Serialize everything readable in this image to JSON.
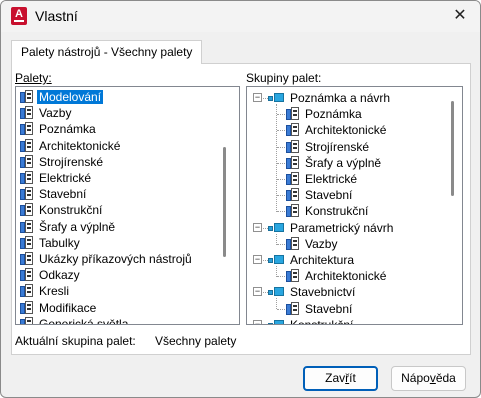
{
  "window": {
    "title": "Vlastní",
    "app_icon_letter": "A"
  },
  "tab": {
    "label": "Palety nástrojů - Všechny palety"
  },
  "palettes": {
    "label": "Palety:",
    "items": [
      "Modelování",
      "Vazby",
      "Poznámka",
      "Architektonické",
      "Strojírenské",
      "Elektrické",
      "Stavební",
      "Konstrukční",
      "Šrafy a výplně",
      "Tabulky",
      "Ukázky příkazových nástrojů",
      "Odkazy",
      "Kresli",
      "Modifikace",
      "Generická světla"
    ],
    "selected": "Modelování"
  },
  "groups": {
    "label": "Skupiny palet:",
    "tree": [
      {
        "name": "Poznámka a návrh",
        "children": [
          "Poznámka",
          "Architektonické",
          "Strojírenské",
          "Šrafy a výplně",
          "Elektrické",
          "Stavební",
          "Konstrukční"
        ]
      },
      {
        "name": "Parametrický návrh",
        "children": [
          "Vazby"
        ]
      },
      {
        "name": "Architektura",
        "children": [
          "Architektonické"
        ]
      },
      {
        "name": "Stavebnictví",
        "children": [
          "Stavební"
        ]
      },
      {
        "name": "Konstrukční",
        "children": []
      }
    ]
  },
  "current_group": {
    "label": "Aktuální skupina palet:",
    "value": "Všechny palety"
  },
  "buttons": {
    "close": {
      "pre": "Zav",
      "accel": "ř",
      "post": "ít"
    },
    "help": {
      "pre": "Nápo",
      "accel": "v",
      "post": "ěda"
    }
  }
}
